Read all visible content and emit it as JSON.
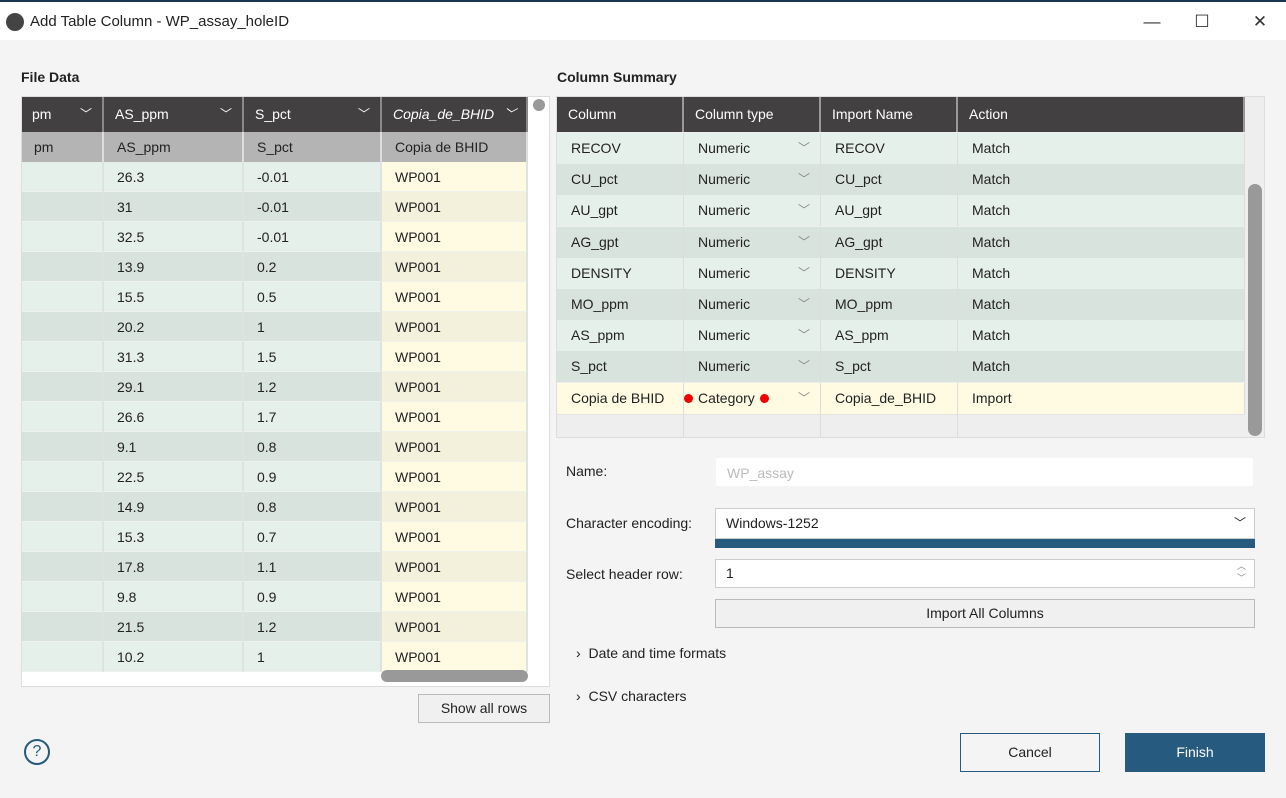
{
  "window": {
    "title": "Add Table Column - WP_assay_holeID",
    "minimize": "—",
    "maximize": "☐",
    "close": "✕"
  },
  "file_data": {
    "title": "File Data",
    "columns": [
      {
        "header": "pm",
        "sub": "pm"
      },
      {
        "header": "AS_ppm",
        "sub": "AS_ppm"
      },
      {
        "header": "S_pct",
        "sub": "S_pct"
      },
      {
        "header": "Copia_de_BHID",
        "sub": "Copia de BHID"
      }
    ],
    "rows": [
      [
        "",
        "26.3",
        "-0.01",
        "WP001"
      ],
      [
        "",
        "31",
        "-0.01",
        "WP001"
      ],
      [
        "",
        "32.5",
        "-0.01",
        "WP001"
      ],
      [
        "",
        "13.9",
        "0.2",
        "WP001"
      ],
      [
        "",
        "15.5",
        "0.5",
        "WP001"
      ],
      [
        "",
        "20.2",
        "1",
        "WP001"
      ],
      [
        "",
        "31.3",
        "1.5",
        "WP001"
      ],
      [
        "",
        "29.1",
        "1.2",
        "WP001"
      ],
      [
        "",
        "26.6",
        "1.7",
        "WP001"
      ],
      [
        "",
        "9.1",
        "0.8",
        "WP001"
      ],
      [
        "",
        "22.5",
        "0.9",
        "WP001"
      ],
      [
        "",
        "14.9",
        "0.8",
        "WP001"
      ],
      [
        "",
        "15.3",
        "0.7",
        "WP001"
      ],
      [
        "",
        "17.8",
        "1.1",
        "WP001"
      ],
      [
        "",
        "9.8",
        "0.9",
        "WP001"
      ],
      [
        "",
        "21.5",
        "1.2",
        "WP001"
      ],
      [
        "",
        "10.2",
        "1",
        "WP001"
      ]
    ],
    "show_all_rows": "Show all rows"
  },
  "column_summary": {
    "title": "Column Summary",
    "headers": [
      "Column",
      "Column type",
      "Import Name",
      "Action"
    ],
    "rows": [
      [
        "RECOV",
        "Numeric",
        "RECOV",
        "Match"
      ],
      [
        "CU_pct",
        "Numeric",
        "CU_pct",
        "Match"
      ],
      [
        "AU_gpt",
        "Numeric",
        "AU_gpt",
        "Match"
      ],
      [
        "AG_gpt",
        "Numeric",
        "AG_gpt",
        "Match"
      ],
      [
        "DENSITY",
        "Numeric",
        "DENSITY",
        "Match"
      ],
      [
        "MO_ppm",
        "Numeric",
        "MO_ppm",
        "Match"
      ],
      [
        "AS_ppm",
        "Numeric",
        "AS_ppm",
        "Match"
      ],
      [
        "S_pct",
        "Numeric",
        "S_pct",
        "Match"
      ],
      [
        "Copia de BHID",
        "Category",
        "Copia_de_BHID",
        "Import"
      ]
    ]
  },
  "form": {
    "name_label": "Name:",
    "name_value": "WP_assay",
    "encoding_label": "Character encoding:",
    "encoding_value": "Windows-1252",
    "header_row_label": "Select header row:",
    "header_row_value": "1",
    "import_all": "Import All Columns",
    "date_formats": "Date and time formats",
    "csv_chars": "CSV characters"
  },
  "footer": {
    "help": "?",
    "cancel": "Cancel",
    "finish": "Finish"
  },
  "colors": {
    "accent": "#265a7e",
    "header": "#434041",
    "row_light": "#e6f0ea",
    "row_dark": "#d9e3dd",
    "highlight": "#fffbe3",
    "error_dot": "#e00000"
  }
}
